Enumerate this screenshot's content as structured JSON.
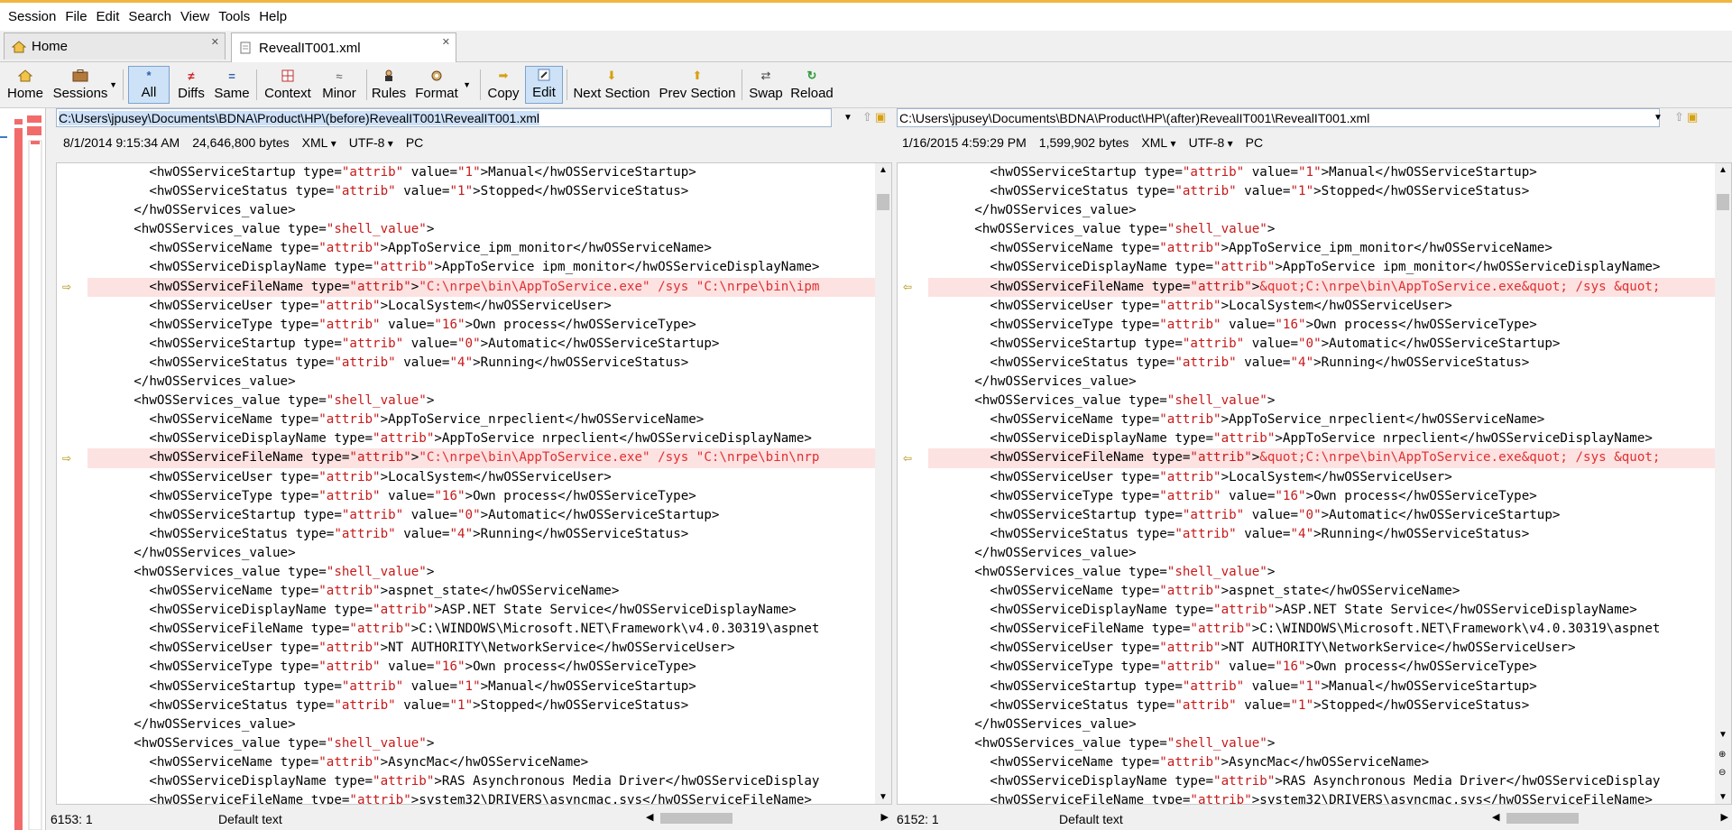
{
  "menu": [
    "Session",
    "File",
    "Edit",
    "Search",
    "View",
    "Tools",
    "Help"
  ],
  "tabs": [
    {
      "label": "Home",
      "active": false
    },
    {
      "label": "RevealIT001.xml",
      "active": true
    }
  ],
  "toolbar": {
    "home": "Home",
    "sessions": "Sessions",
    "all": "All",
    "diffs": "Diffs",
    "same": "Same",
    "context": "Context",
    "minor": "Minor",
    "rules": "Rules",
    "format": "Format",
    "copy": "Copy",
    "edit": "Edit",
    "next_section": "Next Section",
    "prev_section": "Prev Section",
    "swap": "Swap",
    "reload": "Reload"
  },
  "left": {
    "path": "C:\\Users\\jpusey\\Documents\\BDNA\\Product\\HP\\(before)RevealIT001\\RevealIT001.xml",
    "date": "8/1/2014 9:15:34 AM",
    "size": "24,646,800 bytes",
    "format": "XML",
    "encoding": "UTF-8",
    "lineend": "PC",
    "cursor": "6153: 1",
    "mode": "Default text"
  },
  "right": {
    "path": "C:\\Users\\jpusey\\Documents\\BDNA\\Product\\HP\\(after)RevealIT001\\RevealIT001.xml",
    "date": "1/16/2015 4:59:29 PM",
    "size": "1,599,902 bytes",
    "format": "XML",
    "encoding": "UTF-8",
    "lineend": "PC",
    "cursor": "6152: 1",
    "mode": "Default text"
  },
  "lines_left": [
    "        <hwOSServiceStartup type=\"attrib\" value=\"1\">Manual</hwOSServiceStartup>",
    "        <hwOSServiceStatus type=\"attrib\" value=\"1\">Stopped</hwOSServiceStatus>",
    "      </hwOSServices_value>",
    "      <hwOSServices_value type=\"shell_value\">",
    "        <hwOSServiceName type=\"attrib\">AppToService_ipm_monitor</hwOSServiceName>",
    "        <hwOSServiceDisplayName type=\"attrib\">AppToService ipm_monitor</hwOSServiceDisplayName>",
    "        <hwOSServiceFileName type=\"attrib\">\"C:\\nrpe\\bin\\AppToService.exe\" /sys \"C:\\nrpe\\bin\\ipm",
    "        <hwOSServiceUser type=\"attrib\">LocalSystem</hwOSServiceUser>",
    "        <hwOSServiceType type=\"attrib\" value=\"16\">Own process</hwOSServiceType>",
    "        <hwOSServiceStartup type=\"attrib\" value=\"0\">Automatic</hwOSServiceStartup>",
    "        <hwOSServiceStatus type=\"attrib\" value=\"4\">Running</hwOSServiceStatus>",
    "      </hwOSServices_value>",
    "      <hwOSServices_value type=\"shell_value\">",
    "        <hwOSServiceName type=\"attrib\">AppToService_nrpeclient</hwOSServiceName>",
    "        <hwOSServiceDisplayName type=\"attrib\">AppToService nrpeclient</hwOSServiceDisplayName>",
    "        <hwOSServiceFileName type=\"attrib\">\"C:\\nrpe\\bin\\AppToService.exe\" /sys \"C:\\nrpe\\bin\\nrp",
    "        <hwOSServiceUser type=\"attrib\">LocalSystem</hwOSServiceUser>",
    "        <hwOSServiceType type=\"attrib\" value=\"16\">Own process</hwOSServiceType>",
    "        <hwOSServiceStartup type=\"attrib\" value=\"0\">Automatic</hwOSServiceStartup>",
    "        <hwOSServiceStatus type=\"attrib\" value=\"4\">Running</hwOSServiceStatus>",
    "      </hwOSServices_value>",
    "      <hwOSServices_value type=\"shell_value\">",
    "        <hwOSServiceName type=\"attrib\">aspnet_state</hwOSServiceName>",
    "        <hwOSServiceDisplayName type=\"attrib\">ASP.NET State Service</hwOSServiceDisplayName>",
    "        <hwOSServiceFileName type=\"attrib\">C:\\WINDOWS\\Microsoft.NET\\Framework\\v4.0.30319\\aspnet",
    "        <hwOSServiceUser type=\"attrib\">NT AUTHORITY\\NetworkService</hwOSServiceUser>",
    "        <hwOSServiceType type=\"attrib\" value=\"16\">Own process</hwOSServiceType>",
    "        <hwOSServiceStartup type=\"attrib\" value=\"1\">Manual</hwOSServiceStartup>",
    "        <hwOSServiceStatus type=\"attrib\" value=\"1\">Stopped</hwOSServiceStatus>",
    "      </hwOSServices_value>",
    "      <hwOSServices_value type=\"shell_value\">",
    "        <hwOSServiceName type=\"attrib\">AsyncMac</hwOSServiceName>",
    "        <hwOSServiceDisplayName type=\"attrib\">RAS Asynchronous Media Driver</hwOSServiceDisplay",
    "        <hwOSServiceFileName type=\"attrib\">system32\\DRIVERS\\asyncmac.sys</hwOSServiceFileName>"
  ],
  "lines_right": [
    "        <hwOSServiceStartup type=\"attrib\" value=\"1\">Manual</hwOSServiceStartup>",
    "        <hwOSServiceStatus type=\"attrib\" value=\"1\">Stopped</hwOSServiceStatus>",
    "      </hwOSServices_value>",
    "      <hwOSServices_value type=\"shell_value\">",
    "        <hwOSServiceName type=\"attrib\">AppToService_ipm_monitor</hwOSServiceName>",
    "        <hwOSServiceDisplayName type=\"attrib\">AppToService ipm_monitor</hwOSServiceDisplayName>",
    "        <hwOSServiceFileName type=\"attrib\">&quot;C:\\nrpe\\bin\\AppToService.exe&quot; /sys &quot;",
    "        <hwOSServiceUser type=\"attrib\">LocalSystem</hwOSServiceUser>",
    "        <hwOSServiceType type=\"attrib\" value=\"16\">Own process</hwOSServiceType>",
    "        <hwOSServiceStartup type=\"attrib\" value=\"0\">Automatic</hwOSServiceStartup>",
    "        <hwOSServiceStatus type=\"attrib\" value=\"4\">Running</hwOSServiceStatus>",
    "      </hwOSServices_value>",
    "      <hwOSServices_value type=\"shell_value\">",
    "        <hwOSServiceName type=\"attrib\">AppToService_nrpeclient</hwOSServiceName>",
    "        <hwOSServiceDisplayName type=\"attrib\">AppToService nrpeclient</hwOSServiceDisplayName>",
    "        <hwOSServiceFileName type=\"attrib\">&quot;C:\\nrpe\\bin\\AppToService.exe&quot; /sys &quot;",
    "        <hwOSServiceUser type=\"attrib\">LocalSystem</hwOSServiceUser>",
    "        <hwOSServiceType type=\"attrib\" value=\"16\">Own process</hwOSServiceType>",
    "        <hwOSServiceStartup type=\"attrib\" value=\"0\">Automatic</hwOSServiceStartup>",
    "        <hwOSServiceStatus type=\"attrib\" value=\"4\">Running</hwOSServiceStatus>",
    "      </hwOSServices_value>",
    "      <hwOSServices_value type=\"shell_value\">",
    "        <hwOSServiceName type=\"attrib\">aspnet_state</hwOSServiceName>",
    "        <hwOSServiceDisplayName type=\"attrib\">ASP.NET State Service</hwOSServiceDisplayName>",
    "        <hwOSServiceFileName type=\"attrib\">C:\\WINDOWS\\Microsoft.NET\\Framework\\v4.0.30319\\aspnet",
    "        <hwOSServiceUser type=\"attrib\">NT AUTHORITY\\NetworkService</hwOSServiceUser>",
    "        <hwOSServiceType type=\"attrib\" value=\"16\">Own process</hwOSServiceType>",
    "        <hwOSServiceStartup type=\"attrib\" value=\"1\">Manual</hwOSServiceStartup>",
    "        <hwOSServiceStatus type=\"attrib\" value=\"1\">Stopped</hwOSServiceStatus>",
    "      </hwOSServices_value>",
    "      <hwOSServices_value type=\"shell_value\">",
    "        <hwOSServiceName type=\"attrib\">AsyncMac</hwOSServiceName>",
    "        <hwOSServiceDisplayName type=\"attrib\">RAS Asynchronous Media Driver</hwOSServiceDisplay",
    "        <hwOSServiceFileName type=\"attrib\">system32\\DRIVERS\\asyncmac.sys</hwOSServiceFileName>"
  ],
  "diff_lines": [
    6,
    15
  ],
  "colors": {
    "diff_bg": "#fde2e2",
    "diff_text": "#e03030",
    "attr_value": "#c61a1a",
    "accent": "#f0b640",
    "overview_marker": "#f26b6b"
  }
}
